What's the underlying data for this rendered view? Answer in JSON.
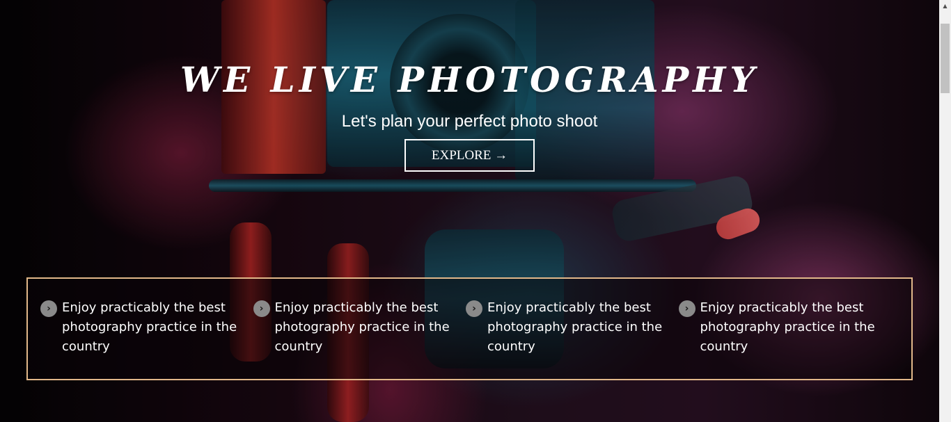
{
  "hero": {
    "title": "WE LIVE PHOTOGRAPHY",
    "subtitle": "Let's plan your perfect photo shoot",
    "explore_label": "EXPLORE →"
  },
  "features": {
    "border_color": "#e2b88a",
    "icon": "chevron-right-icon",
    "items": [
      {
        "text": "Enjoy practicably the best photography practice in the country"
      },
      {
        "text": "Enjoy practicably the best photography practice in the country"
      },
      {
        "text": "Enjoy practicably the best photography practice in the country"
      },
      {
        "text": "Enjoy practicably the best photography practice in the country"
      }
    ]
  },
  "scrollbar": {
    "up_arrow": "▲"
  }
}
